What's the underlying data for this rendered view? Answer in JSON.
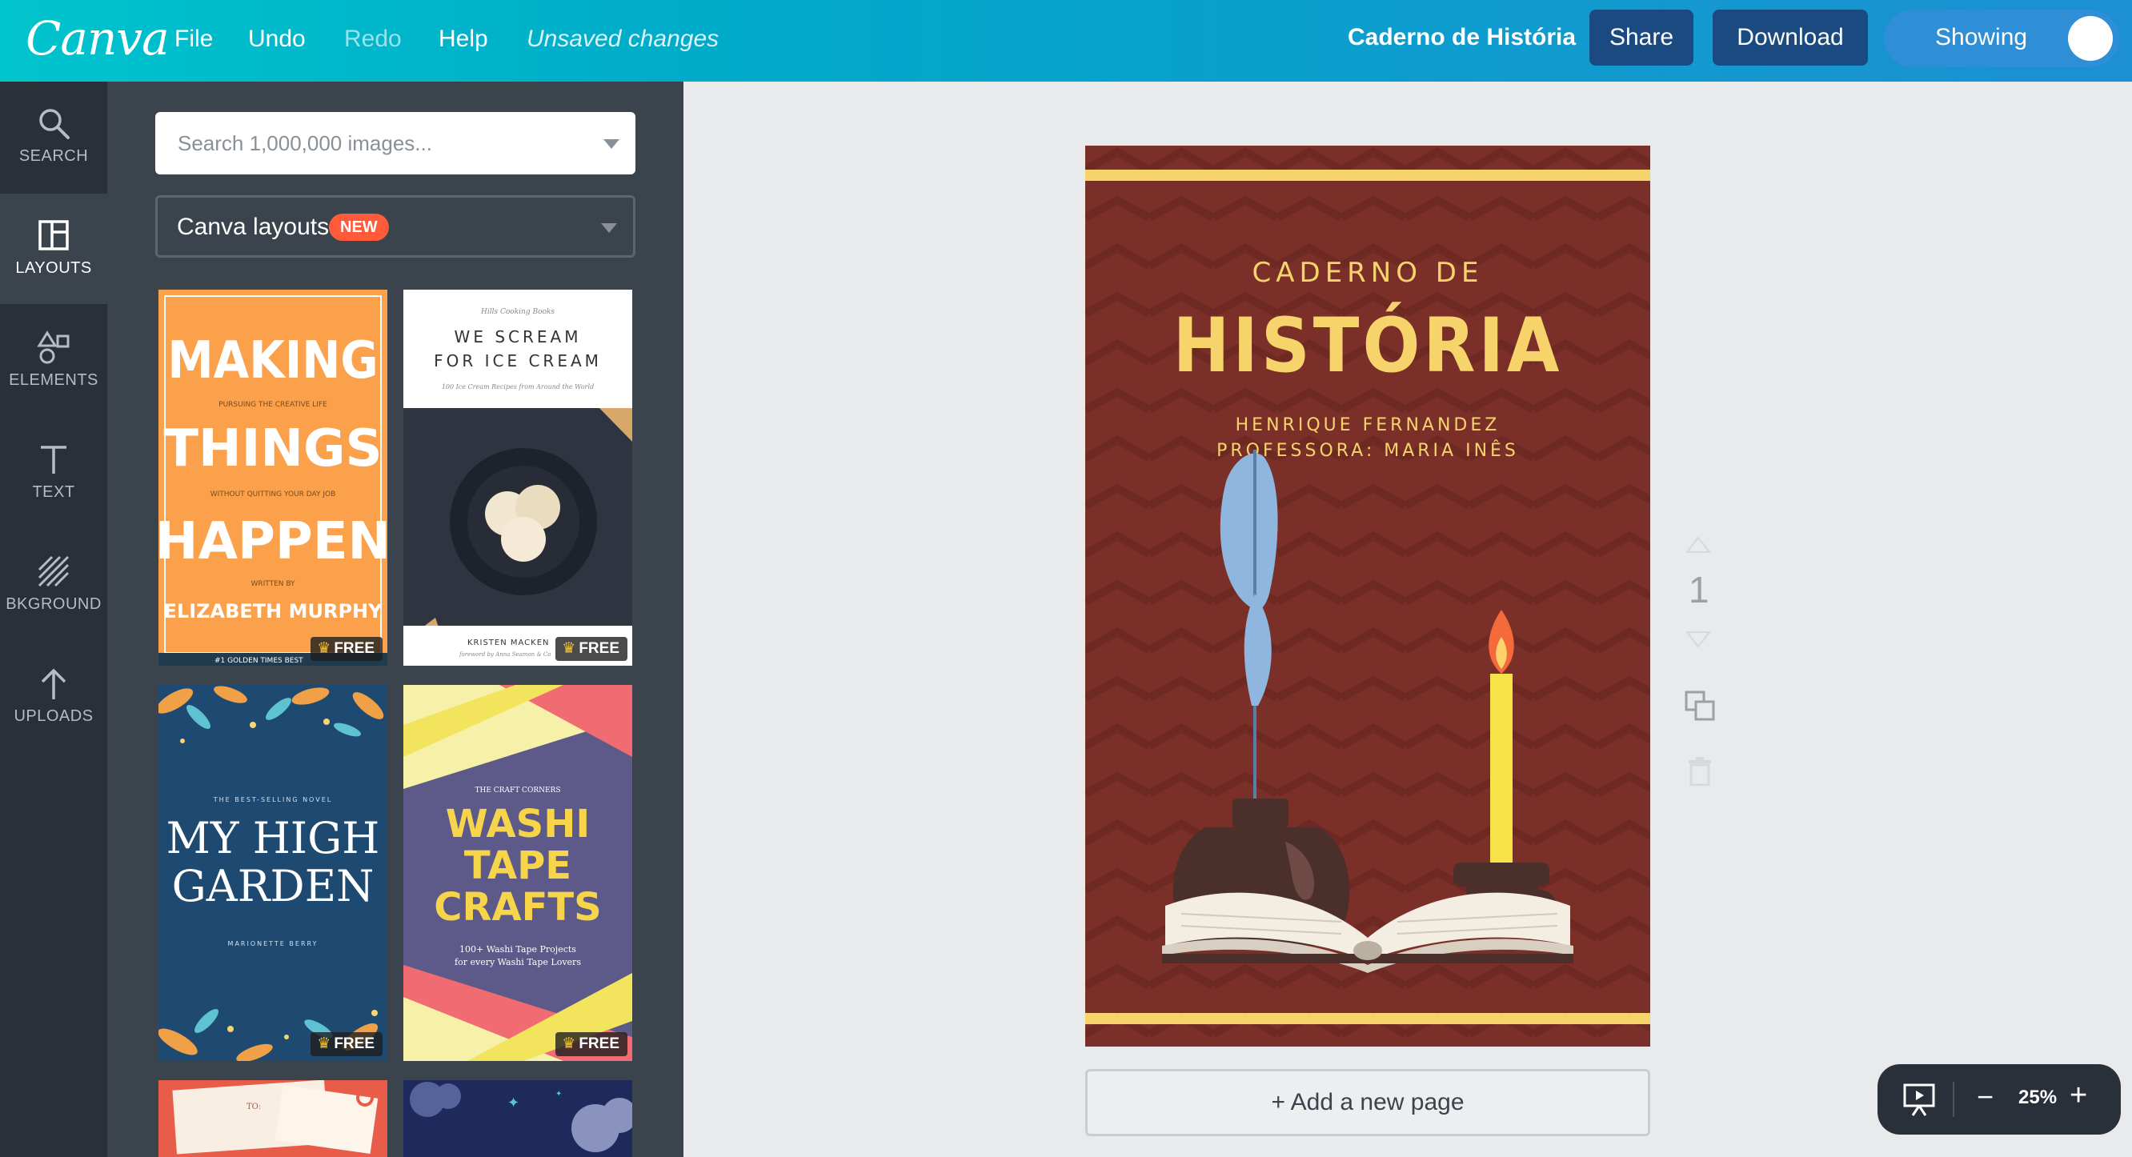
{
  "topbar": {
    "logo": "Canva",
    "menu": {
      "file": "File",
      "undo": "Undo",
      "redo": "Redo",
      "help": "Help",
      "status": "Unsaved changes"
    },
    "doc_title": "Caderno de História",
    "share": "Share",
    "download": "Download",
    "showing": "Showing"
  },
  "rail": {
    "items": [
      {
        "label": "SEARCH",
        "icon": "search-icon"
      },
      {
        "label": "LAYOUTS",
        "icon": "layouts-icon"
      },
      {
        "label": "ELEMENTS",
        "icon": "shapes-icon"
      },
      {
        "label": "TEXT",
        "icon": "text-icon"
      },
      {
        "label": "BKGROUND",
        "icon": "background-icon"
      },
      {
        "label": "UPLOADS",
        "icon": "upload-icon"
      }
    ]
  },
  "panel": {
    "search_placeholder": "Search 1,000,000 images...",
    "layouts_label": "Canva layouts",
    "new_badge": "NEW",
    "free_label": "FREE",
    "thumbs": {
      "making": {
        "line1": "MAKING",
        "sub1": "PURSUING THE CREATIVE LIFE",
        "line2": "THINGS",
        "sub2": "WITHOUT QUITTING YOUR DAY JOB",
        "line3": "HAPPEN",
        "written": "WRITTEN BY",
        "author": "ELIZABETH MURPHY",
        "footer": "#1 GOLDEN TIMES BEST"
      },
      "icecream": {
        "top": "Hills Cooking Books",
        "title1": "WE SCREAM",
        "title2": "FOR ICE CREAM",
        "sub": "100 Ice Cream Recipes from Around the World",
        "author": "KRISTEN MACKEN",
        "foreword": "foreword by Anna Seamon & Co"
      },
      "garden": {
        "kicker": "THE BEST-SELLING NOVEL",
        "title1": "MY HIGH",
        "title2": "GARDEN",
        "author": "MARIONETTE BERRY"
      },
      "washi": {
        "kicker": "THE CRAFT CORNERS",
        "t1": "WASHI",
        "t2": "TAPE",
        "t3": "CRAFTS",
        "sub1": "100+ Washi Tape Projects",
        "sub2": "for every Washi Tape Lovers"
      },
      "letters": {
        "to": "TO:"
      }
    }
  },
  "cover": {
    "line1": "CADERNO DE",
    "line2": "HISTÓRIA",
    "author": "HENRIQUE FERNANDEZ",
    "teacher": "PROFESSORA: MARIA INÊS"
  },
  "canvas": {
    "page_number": "1",
    "add_page": "+ Add a new page",
    "zoom": "25%"
  },
  "colors": {
    "topbar_start": "#00c4cc",
    "topbar_end": "#1c90d2",
    "rail_bg": "#293039",
    "panel_bg": "#3b434d",
    "cover_bg": "#7a2f29",
    "cover_accent": "#f7d46b",
    "new_badge": "#ff5b3a"
  }
}
